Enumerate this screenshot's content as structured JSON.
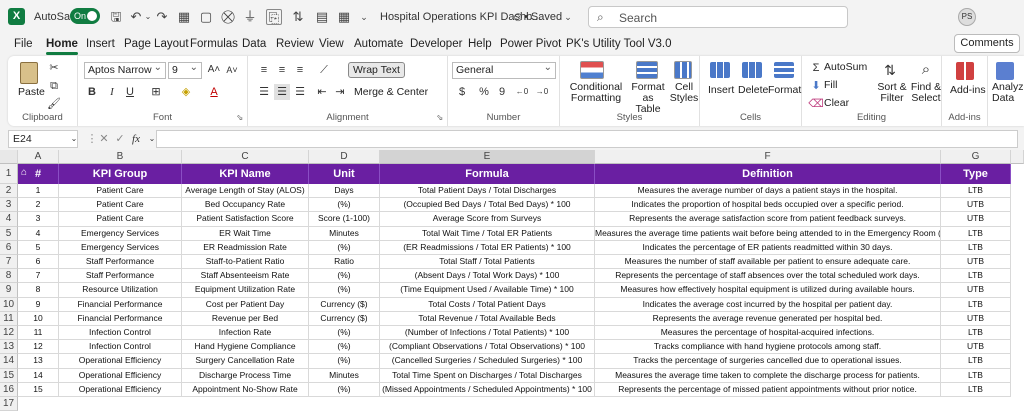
{
  "titlebar": {
    "autosave_label": "AutoSave",
    "toggle_state": "On",
    "document_title": "Hospital Operations KPI Dashb...",
    "saved_status": "• Saved",
    "search_placeholder": "Search",
    "user_initials": "PS"
  },
  "menu": {
    "items": [
      "File",
      "Home",
      "Insert",
      "Page Layout",
      "Formulas",
      "Data",
      "Review",
      "View",
      "Automate",
      "Developer",
      "Help",
      "Power Pivot",
      "PK's Utility Tool V3.0"
    ],
    "active": "Home",
    "comments_label": "Comments"
  },
  "ribbon": {
    "paste_label": "Paste",
    "clipboard_label": "Clipboard",
    "font_name": "Aptos Narrow",
    "font_size": "9",
    "font_label": "Font",
    "wrap_text_label": "Wrap Text",
    "merge_center_label": "Merge & Center",
    "alignment_label": "Alignment",
    "number_format": "General",
    "number_label": "Number",
    "conditional_formatting_label": [
      "Conditional",
      "Formatting"
    ],
    "format_as_table_label": [
      "Format as",
      "Table"
    ],
    "cell_styles_label": [
      "Cell",
      "Styles"
    ],
    "styles_label": "Styles",
    "insert_label": "Insert",
    "delete_label": "Delete",
    "format_label": "Format",
    "cells_label": "Cells",
    "autosum_label": "AutoSum",
    "fill_label": "Fill",
    "clear_label": "Clear",
    "sort_filter_label": [
      "Sort &",
      "Filter"
    ],
    "find_select_label": [
      "Find &",
      "Select"
    ],
    "editing_label": "Editing",
    "addins_label": "Add-ins",
    "addins_group_label": "Add-ins",
    "analyze_label": [
      "Analyze",
      "Data"
    ],
    "brand_color": "#107c41"
  },
  "formula_bar": {
    "cell_ref": "E24",
    "fx_label": "fx",
    "value": ""
  },
  "sheet": {
    "header_color": "#6a1fa2",
    "columns": [
      "A",
      "B",
      "C",
      "D",
      "E",
      "F",
      "G"
    ],
    "headers": [
      "#",
      "KPI Group",
      "KPI Name",
      "Unit",
      "Formula",
      "Definition",
      "Type"
    ],
    "row_numbers": [
      "1",
      "2",
      "3",
      "4",
      "5",
      "6",
      "7",
      "8",
      "9",
      "10",
      "11",
      "12",
      "13",
      "14",
      "15",
      "16",
      "17"
    ],
    "rows": [
      [
        "1",
        "Patient Care",
        "Average Length of Stay (ALOS)",
        "Days",
        "Total Patient Days / Total Discharges",
        "Measures the average number of days a patient stays in the hospital.",
        "LTB"
      ],
      [
        "2",
        "Patient Care",
        "Bed Occupancy Rate",
        "(%)",
        "(Occupied Bed Days / Total Bed Days) * 100",
        "Indicates the proportion of hospital beds occupied over a specific period.",
        "UTB"
      ],
      [
        "3",
        "Patient Care",
        "Patient Satisfaction Score",
        "Score (1-100)",
        "Average Score from Surveys",
        "Represents the average satisfaction score from patient feedback surveys.",
        "UTB"
      ],
      [
        "4",
        "Emergency Services",
        "ER Wait Time",
        "Minutes",
        "Total Wait Time / Total ER Patients",
        "Measures the average time patients wait before being attended to in the Emergency Room (ER).",
        "LTB"
      ],
      [
        "5",
        "Emergency Services",
        "ER Readmission Rate",
        "(%)",
        "(ER Readmissions / Total ER Patients) * 100",
        "Indicates the percentage of ER patients readmitted within 30 days.",
        "LTB"
      ],
      [
        "6",
        "Staff Performance",
        "Staff-to-Patient Ratio",
        "Ratio",
        "Total Staff / Total Patients",
        "Measures the number of staff available per patient to ensure adequate care.",
        "UTB"
      ],
      [
        "7",
        "Staff Performance",
        "Staff Absenteeism Rate",
        "(%)",
        "(Absent Days / Total Work Days) * 100",
        "Represents the percentage of staff absences over the total scheduled work days.",
        "LTB"
      ],
      [
        "8",
        "Resource Utilization",
        "Equipment Utilization Rate",
        "(%)",
        "(Time Equipment Used / Available Time) * 100",
        "Measures how effectively hospital equipment is utilized during available hours.",
        "UTB"
      ],
      [
        "9",
        "Financial Performance",
        "Cost per Patient Day",
        "Currency ($)",
        "Total Costs / Total Patient Days",
        "Indicates the average cost incurred by the hospital per patient day.",
        "LTB"
      ],
      [
        "10",
        "Financial Performance",
        "Revenue per Bed",
        "Currency ($)",
        "Total Revenue / Total Available Beds",
        "Represents the average revenue generated per hospital bed.",
        "UTB"
      ],
      [
        "11",
        "Infection Control",
        "Infection Rate",
        "(%)",
        "(Number of Infections / Total Patients) * 100",
        "Measures the percentage of hospital-acquired infections.",
        "LTB"
      ],
      [
        "12",
        "Infection Control",
        "Hand Hygiene Compliance",
        "(%)",
        "(Compliant Observations / Total Observations) * 100",
        "Tracks compliance with hand hygiene protocols among staff.",
        "UTB"
      ],
      [
        "13",
        "Operational Efficiency",
        "Surgery Cancellation Rate",
        "(%)",
        "(Cancelled Surgeries / Scheduled Surgeries) * 100",
        "Tracks the percentage of surgeries cancelled due to operational issues.",
        "LTB"
      ],
      [
        "14",
        "Operational Efficiency",
        "Discharge Process Time",
        "Minutes",
        "Total Time Spent on Discharges / Total Discharges",
        "Measures the average time taken to complete the discharge process for patients.",
        "LTB"
      ],
      [
        "15",
        "Operational Efficiency",
        "Appointment No-Show Rate",
        "(%)",
        "(Missed Appointments / Scheduled Appointments) * 100",
        "Represents the percentage of missed patient appointments without prior notice.",
        "LTB"
      ]
    ]
  }
}
